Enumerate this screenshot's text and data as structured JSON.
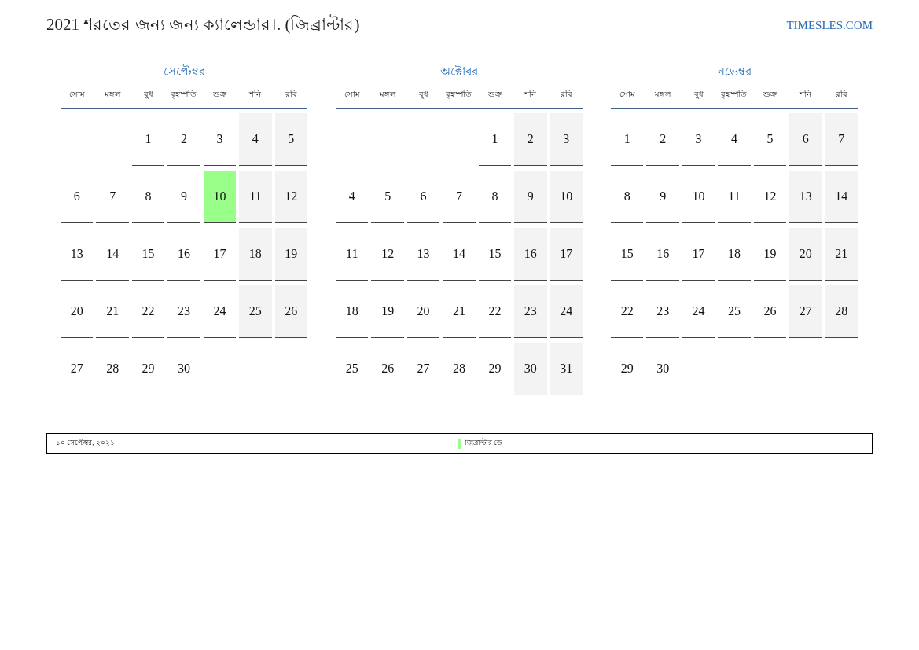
{
  "title": "2021 শরতের জন্য জন্য ক্যালেন্ডার।. (জিব্রাল্টার)",
  "site_link": "TIMESLES.COM",
  "months": [
    {
      "name": "সেপ্টেম্বর",
      "weekdays": [
        "সোম",
        "মঙ্গল",
        "বুধ",
        "বৃহস্পতি",
        "শুক্র",
        "শনি",
        "রবি"
      ],
      "weeks": [
        [
          {
            "kind": "blank"
          },
          {
            "kind": "blank"
          },
          {
            "kind": "day",
            "day": "1",
            "weekend": false,
            "holiday": false
          },
          {
            "kind": "day",
            "day": "2",
            "weekend": false,
            "holiday": false
          },
          {
            "kind": "day",
            "day": "3",
            "weekend": false,
            "holiday": false
          },
          {
            "kind": "day",
            "day": "4",
            "weekend": true,
            "holiday": false
          },
          {
            "kind": "day",
            "day": "5",
            "weekend": true,
            "holiday": false
          }
        ],
        [
          {
            "kind": "day",
            "day": "6",
            "weekend": false,
            "holiday": false
          },
          {
            "kind": "day",
            "day": "7",
            "weekend": false,
            "holiday": false
          },
          {
            "kind": "day",
            "day": "8",
            "weekend": false,
            "holiday": false
          },
          {
            "kind": "day",
            "day": "9",
            "weekend": false,
            "holiday": false
          },
          {
            "kind": "day",
            "day": "10",
            "weekend": false,
            "holiday": true
          },
          {
            "kind": "day",
            "day": "11",
            "weekend": true,
            "holiday": false
          },
          {
            "kind": "day",
            "day": "12",
            "weekend": true,
            "holiday": false
          }
        ],
        [
          {
            "kind": "day",
            "day": "13",
            "weekend": false,
            "holiday": false
          },
          {
            "kind": "day",
            "day": "14",
            "weekend": false,
            "holiday": false
          },
          {
            "kind": "day",
            "day": "15",
            "weekend": false,
            "holiday": false
          },
          {
            "kind": "day",
            "day": "16",
            "weekend": false,
            "holiday": false
          },
          {
            "kind": "day",
            "day": "17",
            "weekend": false,
            "holiday": false
          },
          {
            "kind": "day",
            "day": "18",
            "weekend": true,
            "holiday": false
          },
          {
            "kind": "day",
            "day": "19",
            "weekend": true,
            "holiday": false
          }
        ],
        [
          {
            "kind": "day",
            "day": "20",
            "weekend": false,
            "holiday": false
          },
          {
            "kind": "day",
            "day": "21",
            "weekend": false,
            "holiday": false
          },
          {
            "kind": "day",
            "day": "22",
            "weekend": false,
            "holiday": false
          },
          {
            "kind": "day",
            "day": "23",
            "weekend": false,
            "holiday": false
          },
          {
            "kind": "day",
            "day": "24",
            "weekend": false,
            "holiday": false
          },
          {
            "kind": "day",
            "day": "25",
            "weekend": true,
            "holiday": false
          },
          {
            "kind": "day",
            "day": "26",
            "weekend": true,
            "holiday": false
          }
        ],
        [
          {
            "kind": "day",
            "day": "27",
            "weekend": false,
            "holiday": false
          },
          {
            "kind": "day",
            "day": "28",
            "weekend": false,
            "holiday": false
          },
          {
            "kind": "day",
            "day": "29",
            "weekend": false,
            "holiday": false
          },
          {
            "kind": "day",
            "day": "30",
            "weekend": false,
            "holiday": false
          },
          {
            "kind": "blank"
          },
          {
            "kind": "blank"
          },
          {
            "kind": "blank"
          }
        ]
      ]
    },
    {
      "name": "অক্টোবর",
      "weekdays": [
        "সোম",
        "মঙ্গল",
        "বুধ",
        "বৃহস্পতি",
        "শুক্র",
        "শনি",
        "রবি"
      ],
      "weeks": [
        [
          {
            "kind": "blank"
          },
          {
            "kind": "blank"
          },
          {
            "kind": "blank"
          },
          {
            "kind": "blank"
          },
          {
            "kind": "day",
            "day": "1",
            "weekend": false,
            "holiday": false
          },
          {
            "kind": "day",
            "day": "2",
            "weekend": true,
            "holiday": false
          },
          {
            "kind": "day",
            "day": "3",
            "weekend": true,
            "holiday": false
          }
        ],
        [
          {
            "kind": "day",
            "day": "4",
            "weekend": false,
            "holiday": false
          },
          {
            "kind": "day",
            "day": "5",
            "weekend": false,
            "holiday": false
          },
          {
            "kind": "day",
            "day": "6",
            "weekend": false,
            "holiday": false
          },
          {
            "kind": "day",
            "day": "7",
            "weekend": false,
            "holiday": false
          },
          {
            "kind": "day",
            "day": "8",
            "weekend": false,
            "holiday": false
          },
          {
            "kind": "day",
            "day": "9",
            "weekend": true,
            "holiday": false
          },
          {
            "kind": "day",
            "day": "10",
            "weekend": true,
            "holiday": false
          }
        ],
        [
          {
            "kind": "day",
            "day": "11",
            "weekend": false,
            "holiday": false
          },
          {
            "kind": "day",
            "day": "12",
            "weekend": false,
            "holiday": false
          },
          {
            "kind": "day",
            "day": "13",
            "weekend": false,
            "holiday": false
          },
          {
            "kind": "day",
            "day": "14",
            "weekend": false,
            "holiday": false
          },
          {
            "kind": "day",
            "day": "15",
            "weekend": false,
            "holiday": false
          },
          {
            "kind": "day",
            "day": "16",
            "weekend": true,
            "holiday": false
          },
          {
            "kind": "day",
            "day": "17",
            "weekend": true,
            "holiday": false
          }
        ],
        [
          {
            "kind": "day",
            "day": "18",
            "weekend": false,
            "holiday": false
          },
          {
            "kind": "day",
            "day": "19",
            "weekend": false,
            "holiday": false
          },
          {
            "kind": "day",
            "day": "20",
            "weekend": false,
            "holiday": false
          },
          {
            "kind": "day",
            "day": "21",
            "weekend": false,
            "holiday": false
          },
          {
            "kind": "day",
            "day": "22",
            "weekend": false,
            "holiday": false
          },
          {
            "kind": "day",
            "day": "23",
            "weekend": true,
            "holiday": false
          },
          {
            "kind": "day",
            "day": "24",
            "weekend": true,
            "holiday": false
          }
        ],
        [
          {
            "kind": "day",
            "day": "25",
            "weekend": false,
            "holiday": false
          },
          {
            "kind": "day",
            "day": "26",
            "weekend": false,
            "holiday": false
          },
          {
            "kind": "day",
            "day": "27",
            "weekend": false,
            "holiday": false
          },
          {
            "kind": "day",
            "day": "28",
            "weekend": false,
            "holiday": false
          },
          {
            "kind": "day",
            "day": "29",
            "weekend": false,
            "holiday": false
          },
          {
            "kind": "day",
            "day": "30",
            "weekend": true,
            "holiday": false
          },
          {
            "kind": "day",
            "day": "31",
            "weekend": true,
            "holiday": false
          }
        ]
      ]
    },
    {
      "name": "নভেম্বর",
      "weekdays": [
        "সোম",
        "মঙ্গল",
        "বুধ",
        "বৃহস্পতি",
        "শুক্র",
        "শনি",
        "রবি"
      ],
      "weeks": [
        [
          {
            "kind": "day",
            "day": "1",
            "weekend": false,
            "holiday": false
          },
          {
            "kind": "day",
            "day": "2",
            "weekend": false,
            "holiday": false
          },
          {
            "kind": "day",
            "day": "3",
            "weekend": false,
            "holiday": false
          },
          {
            "kind": "day",
            "day": "4",
            "weekend": false,
            "holiday": false
          },
          {
            "kind": "day",
            "day": "5",
            "weekend": false,
            "holiday": false
          },
          {
            "kind": "day",
            "day": "6",
            "weekend": true,
            "holiday": false
          },
          {
            "kind": "day",
            "day": "7",
            "weekend": true,
            "holiday": false
          }
        ],
        [
          {
            "kind": "day",
            "day": "8",
            "weekend": false,
            "holiday": false
          },
          {
            "kind": "day",
            "day": "9",
            "weekend": false,
            "holiday": false
          },
          {
            "kind": "day",
            "day": "10",
            "weekend": false,
            "holiday": false
          },
          {
            "kind": "day",
            "day": "11",
            "weekend": false,
            "holiday": false
          },
          {
            "kind": "day",
            "day": "12",
            "weekend": false,
            "holiday": false
          },
          {
            "kind": "day",
            "day": "13",
            "weekend": true,
            "holiday": false
          },
          {
            "kind": "day",
            "day": "14",
            "weekend": true,
            "holiday": false
          }
        ],
        [
          {
            "kind": "day",
            "day": "15",
            "weekend": false,
            "holiday": false
          },
          {
            "kind": "day",
            "day": "16",
            "weekend": false,
            "holiday": false
          },
          {
            "kind": "day",
            "day": "17",
            "weekend": false,
            "holiday": false
          },
          {
            "kind": "day",
            "day": "18",
            "weekend": false,
            "holiday": false
          },
          {
            "kind": "day",
            "day": "19",
            "weekend": false,
            "holiday": false
          },
          {
            "kind": "day",
            "day": "20",
            "weekend": true,
            "holiday": false
          },
          {
            "kind": "day",
            "day": "21",
            "weekend": true,
            "holiday": false
          }
        ],
        [
          {
            "kind": "day",
            "day": "22",
            "weekend": false,
            "holiday": false
          },
          {
            "kind": "day",
            "day": "23",
            "weekend": false,
            "holiday": false
          },
          {
            "kind": "day",
            "day": "24",
            "weekend": false,
            "holiday": false
          },
          {
            "kind": "day",
            "day": "25",
            "weekend": false,
            "holiday": false
          },
          {
            "kind": "day",
            "day": "26",
            "weekend": false,
            "holiday": false
          },
          {
            "kind": "day",
            "day": "27",
            "weekend": true,
            "holiday": false
          },
          {
            "kind": "day",
            "day": "28",
            "weekend": true,
            "holiday": false
          }
        ],
        [
          {
            "kind": "day",
            "day": "29",
            "weekend": false,
            "holiday": false
          },
          {
            "kind": "day",
            "day": "30",
            "weekend": false,
            "holiday": false
          },
          {
            "kind": "blank"
          },
          {
            "kind": "blank"
          },
          {
            "kind": "blank"
          },
          {
            "kind": "blank"
          },
          {
            "kind": "blank"
          }
        ]
      ]
    }
  ],
  "holidays": [
    {
      "date": "১০ সেপ্টেম্বর, ২০২১",
      "name": "জিব্রাল্টার ডে"
    }
  ]
}
